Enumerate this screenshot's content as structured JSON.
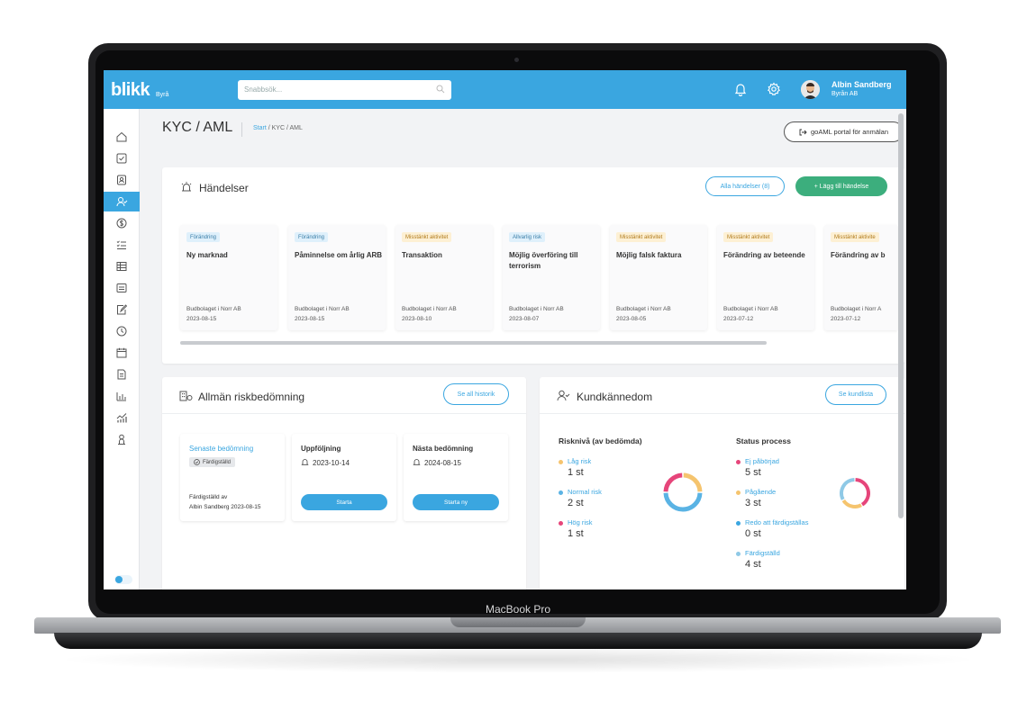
{
  "device_label": "MacBook Pro",
  "header": {
    "logo": "blikk",
    "logo_sub": "Byrå",
    "search_placeholder": "Snabbsök...",
    "user_name": "Albin Sandberg",
    "user_company": "Byrån AB"
  },
  "page": {
    "title": "KYC / AML",
    "breadcrumb_start": "Start",
    "breadcrumb_current": "/ KYC / AML",
    "goaml_button": "goAML portal för anmälan"
  },
  "events": {
    "title": "Händelser",
    "all_button": "Alla händelser (8)",
    "add_button": "+ Lägg till händelse",
    "items": [
      {
        "tag": "Förändring",
        "tag_kind": "change",
        "title": "Ny marknad",
        "company": "Budbolaget i Norr AB",
        "date": "2023-08-15"
      },
      {
        "tag": "Förändring",
        "tag_kind": "change",
        "title": "Påminnelse om årlig ARB",
        "company": "Budbolaget i Norr AB",
        "date": "2023-08-15"
      },
      {
        "tag": "Misstänkt aktivitet",
        "tag_kind": "suspicious",
        "title": "Transaktion",
        "company": "Budbolaget i Norr AB",
        "date": "2023-08-10"
      },
      {
        "tag": "Allvarlig risk",
        "tag_kind": "change",
        "title": "Möjlig överföring till terrorism",
        "company": "Budbolaget i Norr AB",
        "date": "2023-08-07"
      },
      {
        "tag": "Misstänkt aktivitet",
        "tag_kind": "suspicious",
        "title": "Möjlig falsk faktura",
        "company": "Budbolaget i Norr AB",
        "date": "2023-08-05"
      },
      {
        "tag": "Misstänkt aktivitet",
        "tag_kind": "suspicious",
        "title": "Förändring av beteende",
        "company": "Budbolaget i Norr AB",
        "date": "2023-07-12"
      },
      {
        "tag": "Misstänkt aktivite",
        "tag_kind": "suspicious",
        "title": "Förändring av b",
        "company": "Budbolaget i Norr A",
        "date": "2023-07-12"
      }
    ]
  },
  "risk": {
    "title": "Allmän riskbedömning",
    "history_button": "Se all historik",
    "latest_label": "Senaste bedömning",
    "latest_status": "Färdigställd",
    "completed_by_label": "Färdigställd av",
    "completed_by_value": "Albin Sandberg 2023-08-15",
    "followup_title": "Uppföljning",
    "followup_date": "2023-10-14",
    "followup_button": "Starta",
    "next_title": "Nästa bedömning",
    "next_date": "2024-08-15",
    "next_button": "Starta ny"
  },
  "kyc": {
    "title": "Kundkännedom",
    "list_button": "Se kundlista",
    "risk_heading": "Risknivå (av bedömda)",
    "risk_items": [
      {
        "label": "Låg risk",
        "value": "1 st",
        "count": 1,
        "color": "#f5c46e"
      },
      {
        "label": "Normal risk",
        "value": "2 st",
        "count": 2,
        "color": "#5ab3e4"
      },
      {
        "label": "Hög risk",
        "value": "1 st",
        "count": 1,
        "color": "#e6457a"
      }
    ],
    "status_heading": "Status process",
    "status_items": [
      {
        "label": "Ej påbörjad",
        "value": "5 st",
        "count": 5,
        "color": "#e6457a"
      },
      {
        "label": "Pågående",
        "value": "3 st",
        "count": 3,
        "color": "#f5c46e"
      },
      {
        "label": "Redo att färdigställas",
        "value": "0 st",
        "count": 0,
        "color": "#3aa6e0"
      },
      {
        "label": "Färdigställd",
        "value": "4 st",
        "count": 4,
        "color": "#8fc9e6"
      }
    ]
  },
  "colors": {
    "accent": "#3aa6e0",
    "green": "#3cae7d",
    "tag_change_bg": "#dff0fb",
    "tag_suspicious_bg": "#fdf0d4"
  },
  "sidebar_icons": [
    "home-icon",
    "checkbox-icon",
    "contact-icon",
    "user-check-icon",
    "dollar-icon",
    "list-check-icon",
    "table-icon",
    "card-icon",
    "edit-doc-icon",
    "clock-icon",
    "calendar-icon",
    "document-icon",
    "bar-chart-icon",
    "chart-up-icon",
    "person-icon"
  ]
}
